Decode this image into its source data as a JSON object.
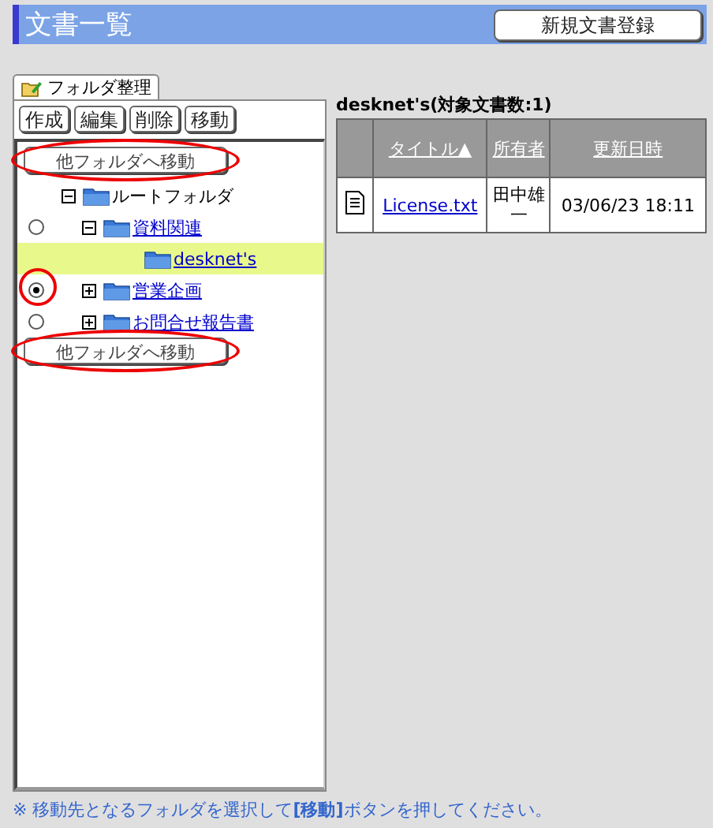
{
  "header": {
    "title": "文書一覧",
    "new_button": "新規文書登録"
  },
  "folder_panel": {
    "tab": "フォルダ整理",
    "toolbar": [
      "作成",
      "編集",
      "削除",
      "移動"
    ],
    "move_buttons": [
      "他フォルダへ移動",
      "他フォルダへ移動"
    ],
    "tree": [
      {
        "label": "ルートフォルダ",
        "kind": "root",
        "expanded": true,
        "children": [
          {
            "label": "資料関連",
            "kind": "option",
            "selected": false,
            "expanded": true,
            "children": [
              {
                "label": "desknet's",
                "kind": "current"
              }
            ]
          },
          {
            "label": "営業企画",
            "kind": "option",
            "selected": true,
            "expanded": false
          },
          {
            "label": "お問合せ報告書",
            "kind": "option",
            "selected": false,
            "expanded": false
          }
        ]
      }
    ]
  },
  "documents": {
    "heading": "desknet's(対象文書数:1)",
    "columns": [
      "タイトル▲",
      "所有者",
      "更新日時"
    ],
    "rows": [
      {
        "title": "License.txt",
        "owner": "田中雄一",
        "updated": "03/06/23 18:11"
      }
    ]
  },
  "note": "※ 移動先となるフォルダを選択して**[移動]**ボタンを押してください。"
}
